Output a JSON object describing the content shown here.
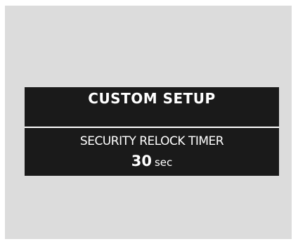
{
  "screen": {
    "title": "CUSTOM SETUP",
    "setting_label": "SECURITY RELOCK TIMER",
    "value": "30",
    "unit": "sec"
  },
  "colors": {
    "background": "#dcdcdc",
    "display": "#1a1a1a",
    "text": "#ffffff"
  }
}
